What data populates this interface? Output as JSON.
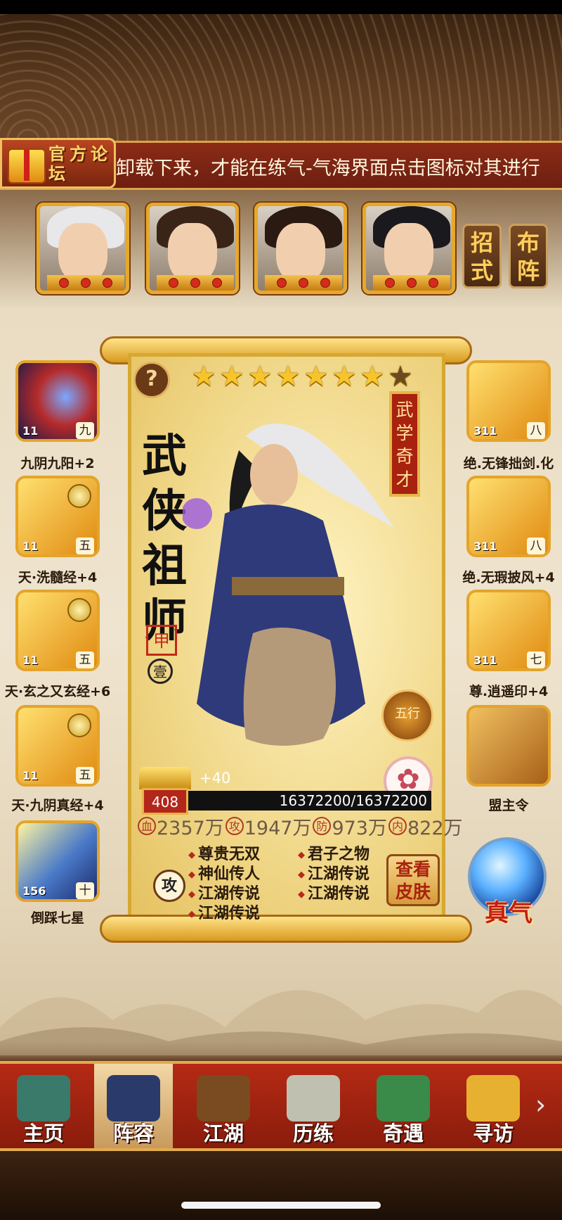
{
  "ticker": {
    "forum_label": "官方论坛",
    "message": "卸载下来，才能在练气-气海界面点击图标对其进行"
  },
  "heroes": [
    {
      "name": "hero-1",
      "hair": "#e8e8ea"
    },
    {
      "name": "hero-2",
      "hair": "#3a2418"
    },
    {
      "name": "hero-3",
      "hair": "#2a1a12"
    },
    {
      "name": "hero-4",
      "hair": "#1a1a1e"
    }
  ],
  "side_buttons": {
    "moves": "招式",
    "formation": "布阵"
  },
  "left_skills": [
    {
      "level": "11",
      "rank": "九",
      "label": "九阴九阳+2"
    },
    {
      "level": "11",
      "rank": "五",
      "label": "天·洗髓经+4"
    },
    {
      "level": "11",
      "rank": "五",
      "label": "天·玄之又玄经+6"
    },
    {
      "level": "11",
      "rank": "五",
      "label": "天·九阴真经+4"
    },
    {
      "level": "156",
      "rank": "十",
      "label": "倒踩七星"
    }
  ],
  "right_skills": [
    {
      "level": "311",
      "rank": "八",
      "label": "绝.无锋拙剑.化"
    },
    {
      "level": "311",
      "rank": "八",
      "label": "绝.无瑕披风+4"
    },
    {
      "level": "311",
      "rank": "七",
      "label": "尊.逍遥印+4"
    },
    {
      "level": "",
      "rank": "",
      "label": "盟主令"
    }
  ],
  "card": {
    "stars_filled": 7,
    "stars_total": 8,
    "title": "武侠祖师",
    "banner": "武学奇才",
    "seal_a": "甲",
    "seal_b": "壹",
    "wuxing": "五行",
    "level": "408",
    "bonus": "+40",
    "hp": "16372200/16372200",
    "stats": [
      {
        "icon": "血",
        "value": "2357万"
      },
      {
        "icon": "攻",
        "value": "1947万"
      },
      {
        "icon": "防",
        "value": "973万"
      },
      {
        "icon": "内",
        "value": "822万"
      }
    ],
    "traits_left": [
      "尊贵无双",
      "神仙传人",
      "江湖传说",
      "江湖传说"
    ],
    "traits_right": [
      "君子之物",
      "江湖传说",
      "江湖传说"
    ],
    "attack_badge": "攻",
    "skin_button": "查看皮肤"
  },
  "zhenqi": "真气",
  "nav": [
    {
      "label": "主页",
      "color": "#3a7a6a"
    },
    {
      "label": "阵容",
      "color": "#2a3a6a"
    },
    {
      "label": "江湖",
      "color": "#7a4a20"
    },
    {
      "label": "历练",
      "color": "#c0c0b0"
    },
    {
      "label": "奇遇",
      "color": "#3a8a4a"
    },
    {
      "label": "寻访",
      "color": "#e8b030"
    }
  ],
  "nav_active": 1
}
